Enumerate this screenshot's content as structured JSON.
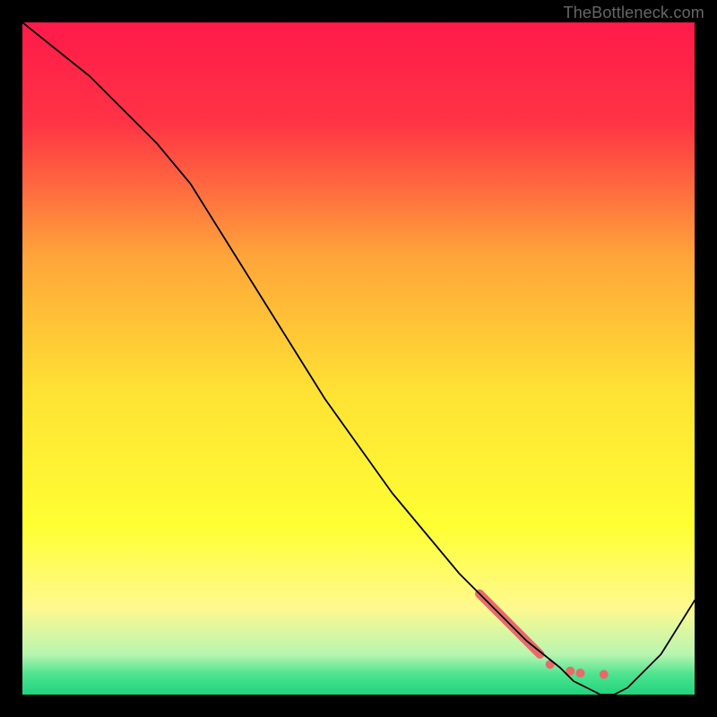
{
  "attribution": "TheBottleneck.com",
  "chart_data": {
    "type": "line",
    "title": "",
    "xlabel": "",
    "ylabel": "",
    "xlim": [
      0,
      100
    ],
    "ylim": [
      0,
      100
    ],
    "background_gradient_stops": [
      {
        "offset": 0.0,
        "color": "#ff1a4a"
      },
      {
        "offset": 0.15,
        "color": "#ff3445"
      },
      {
        "offset": 0.35,
        "color": "#ffa63a"
      },
      {
        "offset": 0.55,
        "color": "#ffe234"
      },
      {
        "offset": 0.75,
        "color": "#ffff33"
      },
      {
        "offset": 0.87,
        "color": "#fff98e"
      },
      {
        "offset": 0.94,
        "color": "#b8f5b0"
      },
      {
        "offset": 0.97,
        "color": "#4de38f"
      },
      {
        "offset": 1.0,
        "color": "#20d47e"
      }
    ],
    "series": [
      {
        "name": "bottleneck-curve",
        "color": "#000000",
        "stroke_width": 1.8,
        "x": [
          0,
          5,
          10,
          15,
          20,
          25,
          30,
          35,
          40,
          45,
          50,
          55,
          60,
          65,
          70,
          75,
          80,
          82,
          84,
          86,
          88,
          90,
          95,
          100
        ],
        "y": [
          100,
          96,
          92,
          87,
          82,
          76,
          68,
          60,
          52,
          44,
          37,
          30,
          24,
          18,
          13,
          8,
          4,
          2,
          1,
          0,
          0,
          1,
          6,
          14
        ]
      }
    ],
    "highlight": {
      "name": "highlight-cluster",
      "color": "#e96a6a",
      "segment": {
        "x": [
          68,
          77
        ],
        "y": [
          15,
          6
        ],
        "width": 10
      },
      "dots": [
        {
          "x": 78.5,
          "y": 4.5,
          "r": 5
        },
        {
          "x": 81.5,
          "y": 3.5,
          "r": 5
        },
        {
          "x": 83.0,
          "y": 3.2,
          "r": 5
        },
        {
          "x": 86.5,
          "y": 3.0,
          "r": 5
        }
      ]
    }
  }
}
